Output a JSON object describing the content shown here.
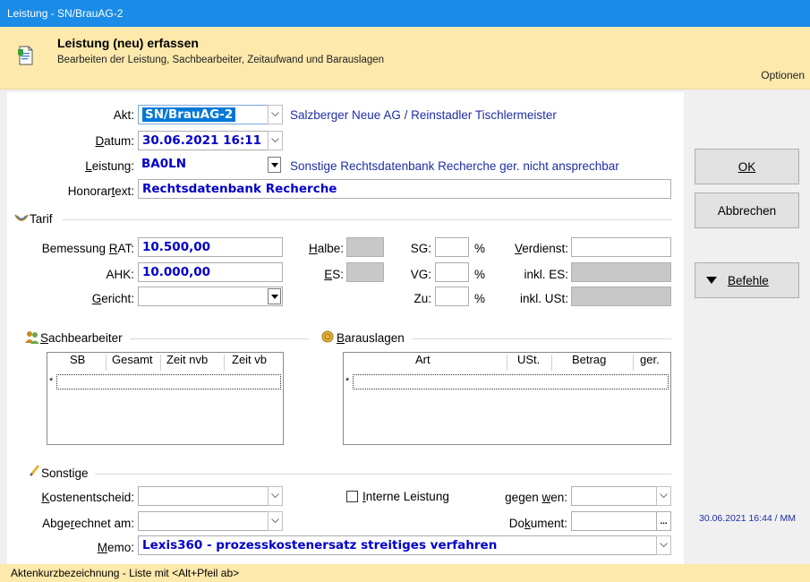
{
  "window": {
    "title": "Leistung - SN/BrauAG-2"
  },
  "header": {
    "title": "Leistung (neu) erfassen",
    "subtitle": "Bearbeiten der Leistung, Sachbearbeiter, Zeitaufwand und Barauslagen",
    "options_label": "Optionen"
  },
  "form": {
    "akt": {
      "label": "Akt:",
      "value": "SN/BrauAG-2",
      "info": "Salzberger Neue AG / Reinstadler Tischlermeister"
    },
    "datum": {
      "label": "Datum:",
      "value": "30.06.2021 16:11"
    },
    "leistung": {
      "label": "Leistung:",
      "value": "BA0LN",
      "info": "Sonstige Rechtsdatenbank Recherche ger. nicht ansprechbar"
    },
    "honorartext": {
      "label": "Honorartext:",
      "value": "Rechtsdatenbank Recherche"
    }
  },
  "tarif": {
    "section_label": "Tarif",
    "bemessung": {
      "label": "Bemessung RAT:",
      "value": "10.500,00"
    },
    "ahk": {
      "label": "AHK:",
      "value": "10.000,00"
    },
    "gericht": {
      "label": "Gericht:",
      "value": ""
    },
    "halbe_label": "Halbe:",
    "es_label": "ES:",
    "sg_label": "SG:",
    "vg_label": "VG:",
    "zu_label": "Zu:",
    "percent": "%",
    "verdienst_label": "Verdienst:",
    "inkl_es_label": "inkl. ES:",
    "inkl_ust_label": "inkl. USt:"
  },
  "sachbearbeiter": {
    "section_label": "Sachbearbeiter",
    "columns": [
      "SB",
      "Gesamt",
      "Zeit nvb",
      "Zeit vb"
    ],
    "new_row_marker": "*"
  },
  "barauslagen": {
    "section_label": "Barauslagen",
    "columns": [
      "Art",
      "USt.",
      "Betrag",
      "ger."
    ],
    "new_row_marker": "*"
  },
  "sonstige": {
    "section_label": "Sonstige",
    "kostenentscheid_label": "Kostenentscheid:",
    "abgerechnet_label": "Abgerechnet am:",
    "interne_leistung_label": "Interne Leistung",
    "interne_leistung_checked": false,
    "gegen_wen_label": "gegen wen:",
    "dokument_label": "Dokument:",
    "dokument_button": "...",
    "memo_label": "Memo:",
    "memo_value": "Lexis360 - prozesskostenersatz streitiges verfahren"
  },
  "sidebar": {
    "ok_label": "OK",
    "cancel_label": "Abbrechen",
    "befehle_label": "Befehle",
    "timestamp": "30.06.2021 16:44 / MM"
  },
  "status": {
    "text": "Aktenkurzbezeichnung - Liste mit <Alt+Pfeil ab>"
  },
  "colors": {
    "titlebar": "#1a8be6",
    "header_bg": "#fde9ac",
    "value_blue": "#0000c8",
    "info_blue": "#1d2ea8",
    "selection": "#0078d7"
  }
}
